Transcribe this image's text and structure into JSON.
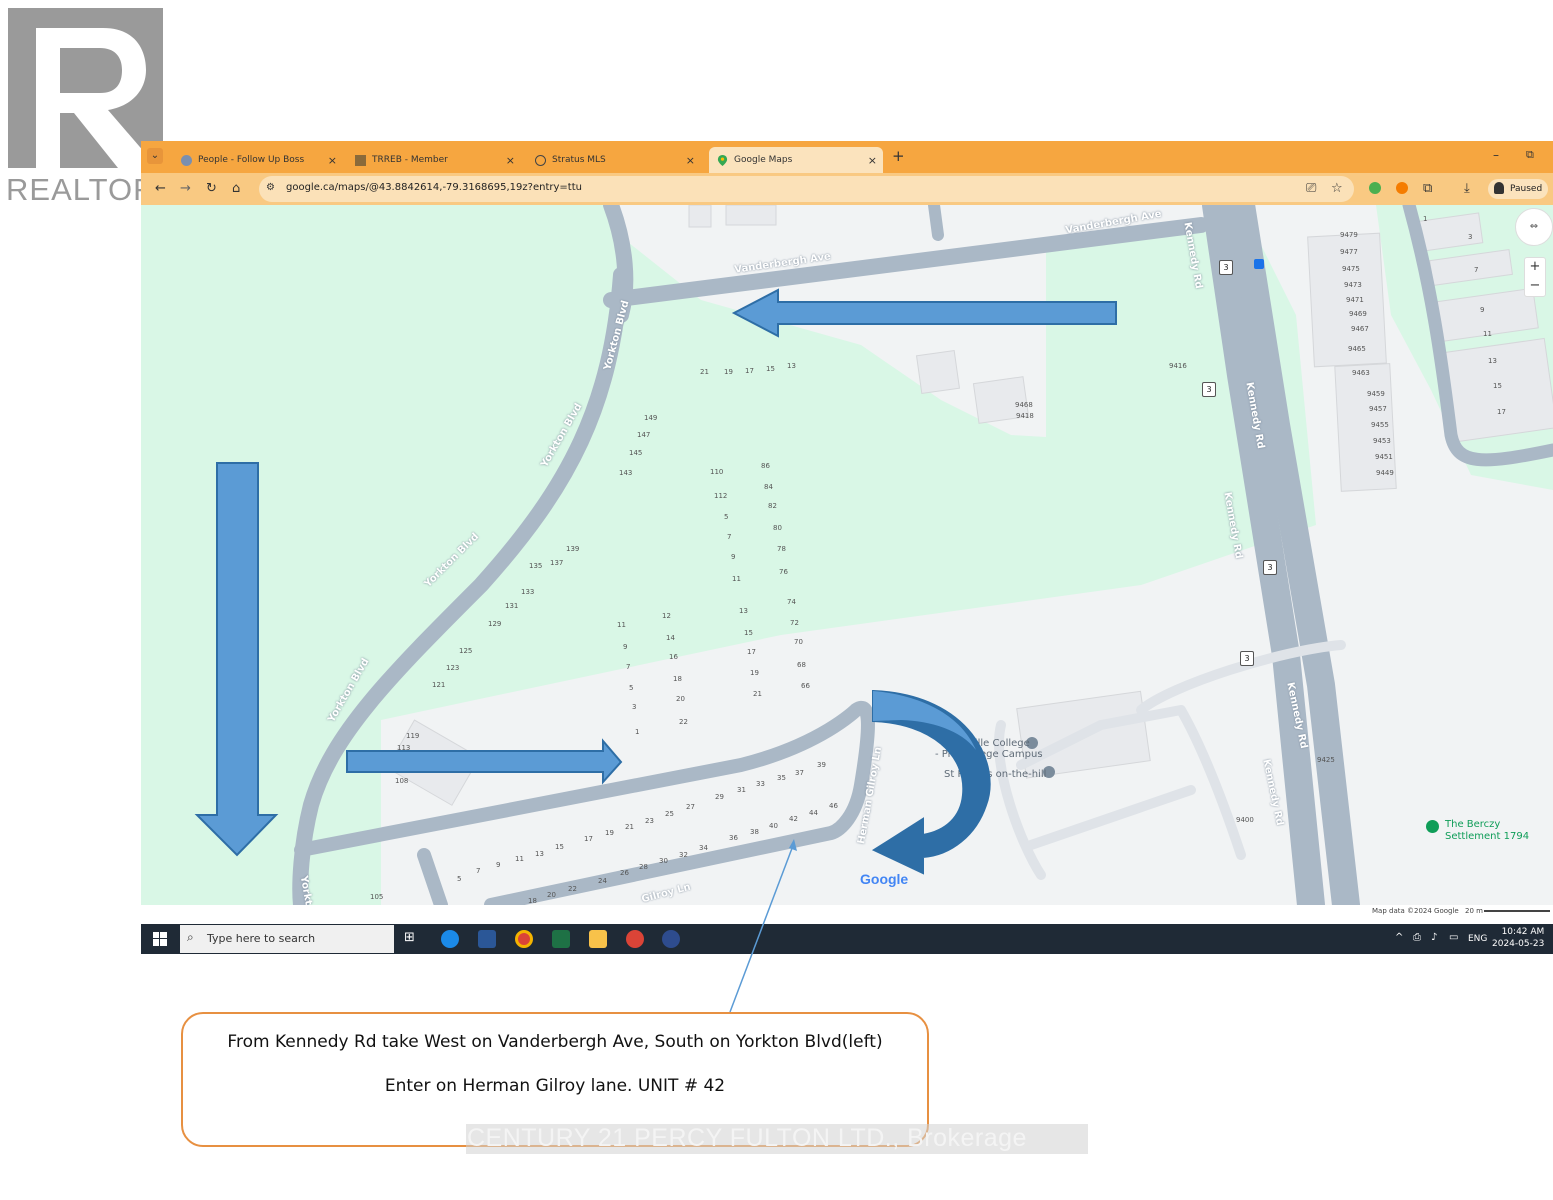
{
  "watermark": {
    "brand": "REALTOR",
    "registered": "®",
    "logo_letter": "R"
  },
  "browser": {
    "tabs": [
      {
        "label": "People - Follow Up Boss",
        "close": "×"
      },
      {
        "label": "TRREB - Member",
        "close": "×"
      },
      {
        "label": "Stratus MLS",
        "close": "×"
      },
      {
        "label": "Google Maps",
        "close": "×",
        "active": true
      }
    ],
    "new_tab": "+",
    "url": "google.ca/maps/@43.8842614,-79.3168695,19z?entry=ttu",
    "profile_status": "Paused",
    "window_controls": {
      "minimize": "–",
      "restore": "⧉"
    }
  },
  "map": {
    "roads": {
      "vanderbergh_1": "Vanderbergh Ave",
      "vanderbergh_2": "Vanderbergh Ave",
      "yorkton_1": "Yorkton Blvd",
      "yorkton_2": "Yorkton Blvd",
      "yorkton_3": "Yorkton Blvd",
      "yorkton_4": "Yorkton Blvd",
      "yorkton_5": "Yorkt",
      "kennedy_1": "Kennedy Rd",
      "kennedy_2": "Kennedy Rd",
      "kennedy_3": "Kennedy Rd",
      "kennedy_4": "Kennedy Rd",
      "kennedy_5": "Kennedy Rd",
      "herman_1": "Herman Gilroy Ln",
      "herman_2": "Gilroy Ln"
    },
    "shield_number": "3",
    "pois": {
      "college_1": "Unionville College",
      "college_2": "- Pre-College Campus",
      "church": "St Philip's on-the-hill",
      "berczy_1": "The Berczy",
      "berczy_2": "Settlement 1794"
    },
    "logo": "Google",
    "attribution": "Map data ©2024 Google",
    "scale": "20 m",
    "zoom_in": "+",
    "zoom_out": "−",
    "house_numbers": {
      "a1": "21",
      "a2": "19",
      "a3": "17",
      "a4": "15",
      "a5": "13",
      "b1": "149",
      "b2": "147",
      "b3": "145",
      "b4": "143",
      "c1": "110",
      "c2": "112",
      "c3": "5",
      "c4": "7",
      "c5": "9",
      "c6": "11",
      "d1": "86",
      "d2": "84",
      "d3": "82",
      "d4": "80",
      "d5": "78",
      "d6": "76",
      "d7": "74",
      "d8": "72",
      "d9": "70",
      "d10": "68",
      "d11": "66",
      "e1": "139",
      "e2": "137",
      "e3": "135",
      "e4": "133",
      "e5": "131",
      "e6": "129",
      "e7": "125",
      "e8": "123",
      "e9": "121",
      "f1": "11",
      "f2": "9",
      "f3": "7",
      "f4": "5",
      "f5": "3",
      "f6": "1",
      "g1": "12",
      "g2": "14",
      "g3": "16",
      "g4": "18",
      "g5": "20",
      "g6": "22",
      "h1": "13",
      "h2": "15",
      "h3": "17",
      "h4": "19",
      "h5": "21",
      "i1": "119",
      "i2": "113",
      "i3": "108",
      "i4": "105",
      "j1": "39",
      "j2": "37",
      "j3": "35",
      "j4": "33",
      "j5": "31",
      "j6": "29",
      "j7": "27",
      "j8": "25",
      "j9": "23",
      "j10": "21",
      "j11": "19",
      "j12": "17",
      "j13": "15",
      "j14": "13",
      "j15": "11",
      "j16": "9",
      "j17": "7",
      "j18": "5",
      "k1": "46",
      "k2": "44",
      "k3": "42",
      "k4": "40",
      "k5": "38",
      "k6": "36",
      "k7": "34",
      "k8": "32",
      "k9": "30",
      "k10": "28",
      "k11": "26",
      "k12": "24",
      "k13": "22",
      "k14": "20",
      "k15": "18",
      "l1": "9479",
      "l2": "9477",
      "l3": "9475",
      "l4": "9473",
      "l5": "9471",
      "l6": "9469",
      "l7": "9467",
      "l8": "9465",
      "l9": "9463",
      "l10": "9459",
      "l11": "9457",
      "l12": "9455",
      "l13": "9453",
      "l14": "9451",
      "l15": "9449",
      "m1": "1",
      "m2": "3",
      "m3": "7",
      "m4": "9",
      "m5": "11",
      "m6": "13",
      "m7": "15",
      "m8": "17",
      "n1": "9468",
      "n2": "9418",
      "n3": "9416",
      "n4": "9425",
      "n5": "9400"
    }
  },
  "taskbar": {
    "search_placeholder": "Type here to search",
    "time": "10:42 AM",
    "date": "2024-05-23",
    "lang": "ENG"
  },
  "callout": {
    "line1": "From Kennedy Rd take West on Vanderbergh Ave, South on Yorkton Blvd(left)",
    "line2": "Enter on Herman Gilroy lane. UNIT # 42"
  },
  "footer_watermark": "CENTURY 21 PERCY FULTON LTD., Brokerage",
  "colors": {
    "tab_bar": "#f6a640",
    "park": "#d9f7e6",
    "road": "#aab8c6",
    "arrow": "#5b9bd5",
    "arrow_dark": "#2e6ea6",
    "callout_border": "#e79041"
  }
}
